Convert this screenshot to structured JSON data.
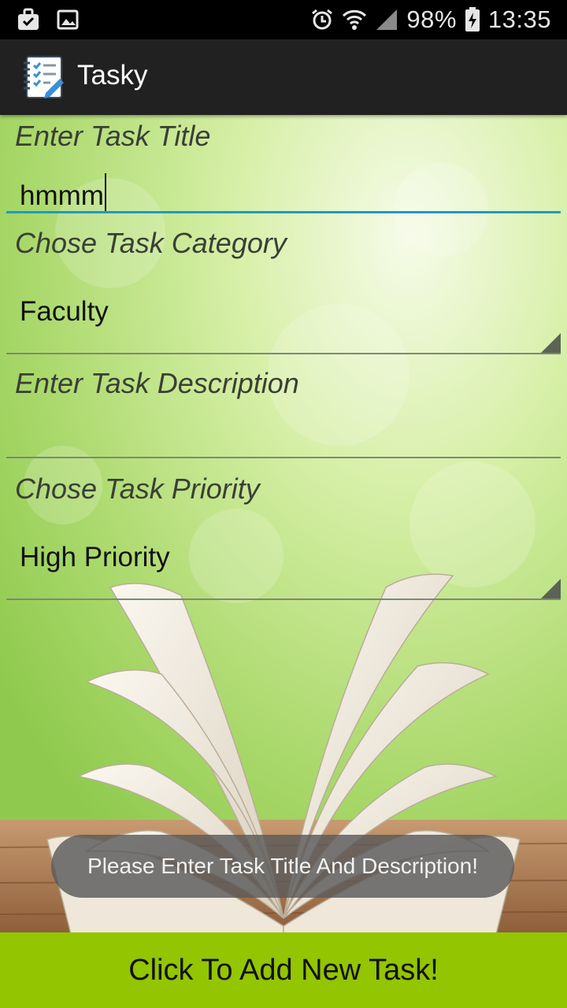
{
  "status_bar": {
    "battery": "98%",
    "time": "13:35",
    "icons": [
      "bag-notification-icon",
      "image-notification-icon",
      "alarm-icon",
      "wifi-icon",
      "signal-icon",
      "battery-charging-icon"
    ]
  },
  "app_bar": {
    "title": "Tasky",
    "icon": "checklist-icon"
  },
  "form": {
    "title_label": "Enter Task Title",
    "title_value": "hmmm",
    "category_label": "Chose Task Category",
    "category_value": "Faculty",
    "description_label": "Enter Task Description",
    "description_value": "",
    "priority_label": "Chose Task Priority",
    "priority_value": "High Priority"
  },
  "toast": {
    "message": "Please Enter Task Title And Description!"
  },
  "add_button": {
    "label": "Click To Add New Task!"
  },
  "colors": {
    "accent": "#1e9bbf",
    "button": "#93c500",
    "app_bar": "#212121"
  }
}
